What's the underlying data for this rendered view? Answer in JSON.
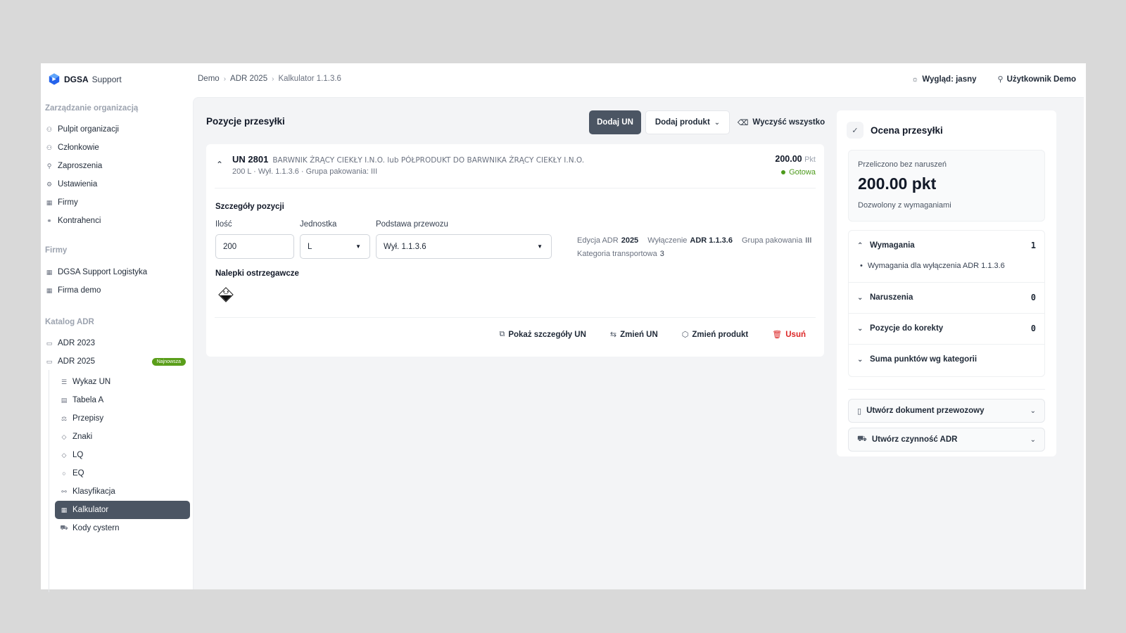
{
  "brand": {
    "name_bold": "DGSA",
    "name_rest": "Support"
  },
  "sidebar": {
    "org_section": "Zarządzanie organizacją",
    "org_items": [
      {
        "label": "Pulpit organizacji",
        "icon": "users-icon"
      },
      {
        "label": "Członkowie",
        "icon": "users-icon"
      },
      {
        "label": "Zaproszenia",
        "icon": "user-plus-icon"
      },
      {
        "label": "Ustawienia",
        "icon": "gear-icon"
      },
      {
        "label": "Firmy",
        "icon": "building-icon"
      },
      {
        "label": "Kontrahenci",
        "icon": "handshake-icon"
      }
    ],
    "firms_section": "Firmy",
    "firms_items": [
      {
        "label": "DGSA Support Logistyka",
        "icon": "building-icon"
      },
      {
        "label": "Firma demo",
        "icon": "building-icon"
      }
    ],
    "catalog_section": "Katalog ADR",
    "catalog_items": [
      {
        "label": "ADR 2023",
        "icon": "book-icon"
      },
      {
        "label": "ADR 2025",
        "icon": "book-icon",
        "badge": "Najnowsza"
      }
    ],
    "adr_sub_items": [
      {
        "label": "Wykaz UN",
        "icon": "list-icon"
      },
      {
        "label": "Tabela A",
        "icon": "table-icon"
      },
      {
        "label": "Przepisy",
        "icon": "scale-icon"
      },
      {
        "label": "Znaki",
        "icon": "diamond-icon"
      },
      {
        "label": "LQ",
        "icon": "diamond-icon"
      },
      {
        "label": "EQ",
        "icon": "circle-icon"
      },
      {
        "label": "Klasyfikacja",
        "icon": "tree-icon"
      },
      {
        "label": "Kalkulator",
        "icon": "calculator-icon",
        "active": true
      },
      {
        "label": "Kody cystern",
        "icon": "truck-icon"
      }
    ]
  },
  "header": {
    "breadcrumb": [
      "Demo",
      "ADR 2025",
      "Kalkulator 1.1.3.6"
    ],
    "theme_label": "Wygląd: jasny",
    "user_label": "Użytkownik Demo"
  },
  "shipment": {
    "title": "Pozycje przesyłki",
    "add_un": "Dodaj UN",
    "add_product": "Dodaj produkt",
    "clear_all": "Wyczyść wszystko",
    "item": {
      "un": "UN 2801",
      "name": "BARWNIK ŻRĄCY CIEKŁY I.N.O. lub PÓŁPRODUKT DO BARWNIKA ŻRĄCY CIEKŁY I.N.O.",
      "summary": "200 L · Wył. 1.1.3.6 · Grupa pakowania: III",
      "points": "200.00",
      "points_unit": "Pkt",
      "status": "Gotowa",
      "details_title": "Szczegóły pozycji",
      "qty_label": "Ilość",
      "qty_value": "200",
      "unit_label": "Jednostka",
      "unit_value": "L",
      "basis_label": "Podstawa przewozu",
      "basis_value": "Wył. 1.1.3.6",
      "edition_label": "Edycja ADR",
      "edition_value": "2025",
      "exemption_label": "Wyłączenie",
      "exemption_value": "ADR 1.1.3.6",
      "pg_label": "Grupa pakowania",
      "pg_value": "III",
      "transport_cat_label": "Kategoria transportowa",
      "transport_cat_value": "3",
      "labels_title": "Nalepki ostrzegawcze",
      "actions": {
        "show_details": "Pokaż szczegóły UN",
        "change_un": "Zmień UN",
        "change_product": "Zmień produkt",
        "delete": "Usuń"
      }
    }
  },
  "assessment": {
    "title": "Ocena przesyłki",
    "calc_note": "Przeliczono bez naruszeń",
    "score": "200.00 pkt",
    "verdict": "Dozwolony z wymaganiami",
    "requirements_label": "Wymagania",
    "requirements_count": "1",
    "requirement_item": "Wymagania dla wyłączenia ADR 1.1.3.6",
    "violations_label": "Naruszenia",
    "violations_count": "0",
    "corrections_label": "Pozycje do korekty",
    "corrections_count": "0",
    "sum_label": "Suma punktów wg kategorii",
    "create_doc": "Utwórz dokument przewozowy",
    "create_activity": "Utwórz czynność ADR"
  },
  "colors": {
    "accent_dark": "#4b5563",
    "status_green": "#4d9a1c",
    "danger": "#dc2626",
    "badge_green": "#5a9e1a"
  }
}
